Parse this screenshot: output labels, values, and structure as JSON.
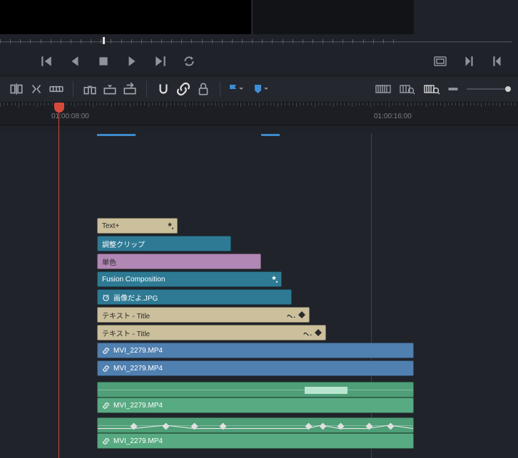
{
  "ruler": {
    "label1": "01:00:08:00",
    "label2": "01:00:16:00"
  },
  "clips": {
    "textplus": "Text+",
    "adjustment": "調整クリップ",
    "solid": "単色",
    "fusion": "Fusion Composition",
    "image": "画像だよ.JPG",
    "title1": "テキスト - Title",
    "title2": "テキスト - Title",
    "video1": "MVI_2279.MP4",
    "video2": "MVI_2279.MP4",
    "audio1": "MVI_2279.MP4",
    "audio2": "MVI_2279.MP4"
  },
  "toolbar_icons": {
    "selection": "selection",
    "trim_edit": "trim-edit",
    "dynamic_trim": "dynamic-trim",
    "insert": "insert",
    "overwrite": "overwrite",
    "replace": "replace",
    "snap": "snap",
    "link": "link",
    "lock": "lock",
    "flag_blue": "flag",
    "marker_blue": "marker",
    "zoom_full": "zoom-full",
    "zoom_detail": "zoom-detail",
    "zoom_custom": "zoom-custom"
  },
  "colors": {
    "playhead": "#d64a3a",
    "flag": "#3f8dd6",
    "beige": "#cbbf9c",
    "teal": "#2e7a94",
    "purple": "#b187b5",
    "blue": "#5080b0",
    "green": "#58aa82"
  }
}
